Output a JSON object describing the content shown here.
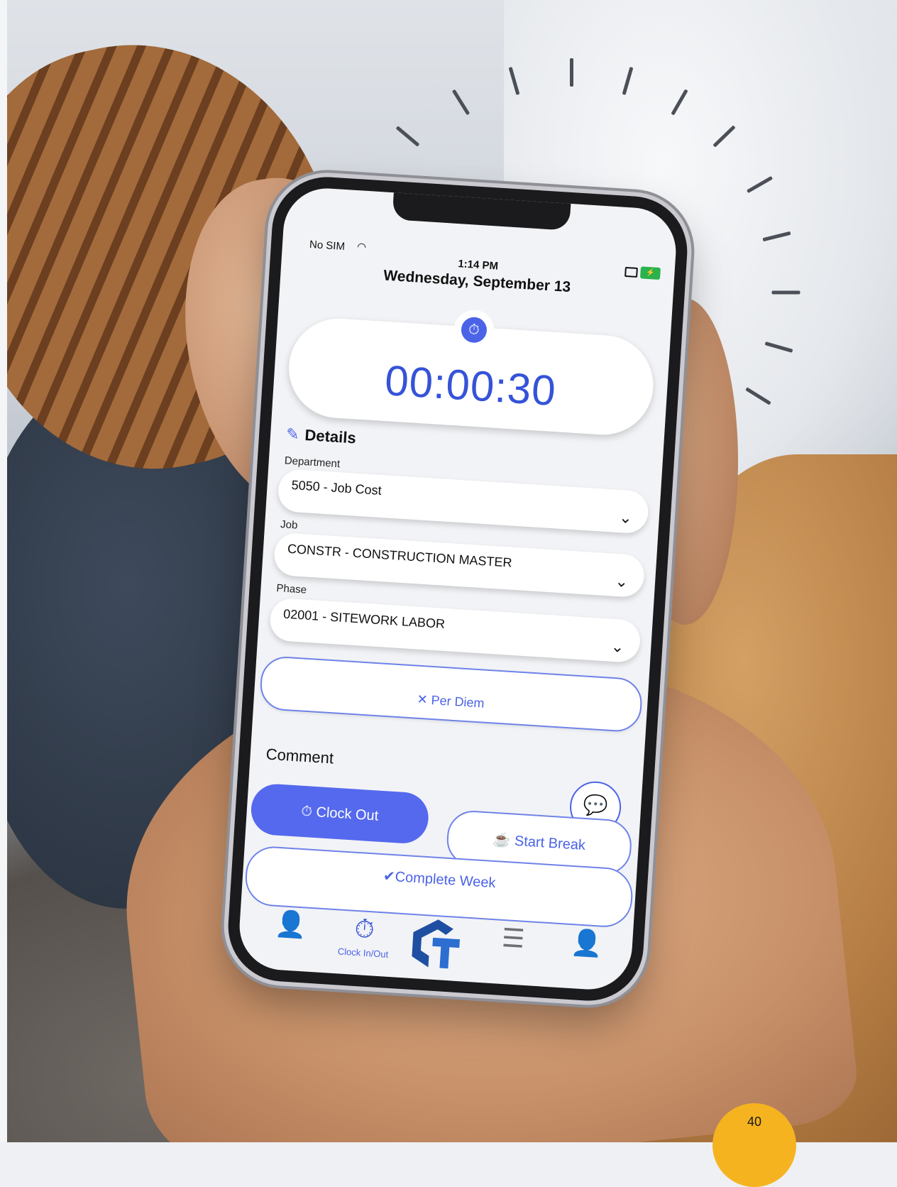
{
  "status_bar": {
    "carrier": "No SIM",
    "time": "1:14 PM",
    "date": "Wednesday, September 13"
  },
  "timer": {
    "elapsed": "00:00:30",
    "icon": "stopwatch-icon",
    "accent_color": "#3553d8"
  },
  "details": {
    "title": "Details",
    "fields": [
      {
        "label": "Department",
        "value": "5050 - Job Cost"
      },
      {
        "label": "Job",
        "value": "CONSTR - CONSTRUCTION MASTER"
      },
      {
        "label": "Phase",
        "value": "02001 - SITEWORK LABOR"
      }
    ]
  },
  "per_diem": {
    "label": "Per Diem",
    "icon": "close-icon"
  },
  "comment": {
    "label": "Comment",
    "icon": "chat-bubble-icon"
  },
  "actions": {
    "clock_out": "Clock Out",
    "start_break": "Start Break",
    "complete_week": "Complete Week"
  },
  "tabbar": {
    "items": [
      {
        "icon": "user-clock-icon",
        "label": ""
      },
      {
        "icon": "stopwatch-icon",
        "label": "Clock In/Out"
      },
      {
        "icon": "ct-logo",
        "label": ""
      },
      {
        "icon": "list-icon",
        "label": ""
      },
      {
        "icon": "profile-icon",
        "label": ""
      }
    ]
  },
  "page_number": "40",
  "colors": {
    "primary": "#5569ee",
    "badge": "#f5b31f"
  }
}
